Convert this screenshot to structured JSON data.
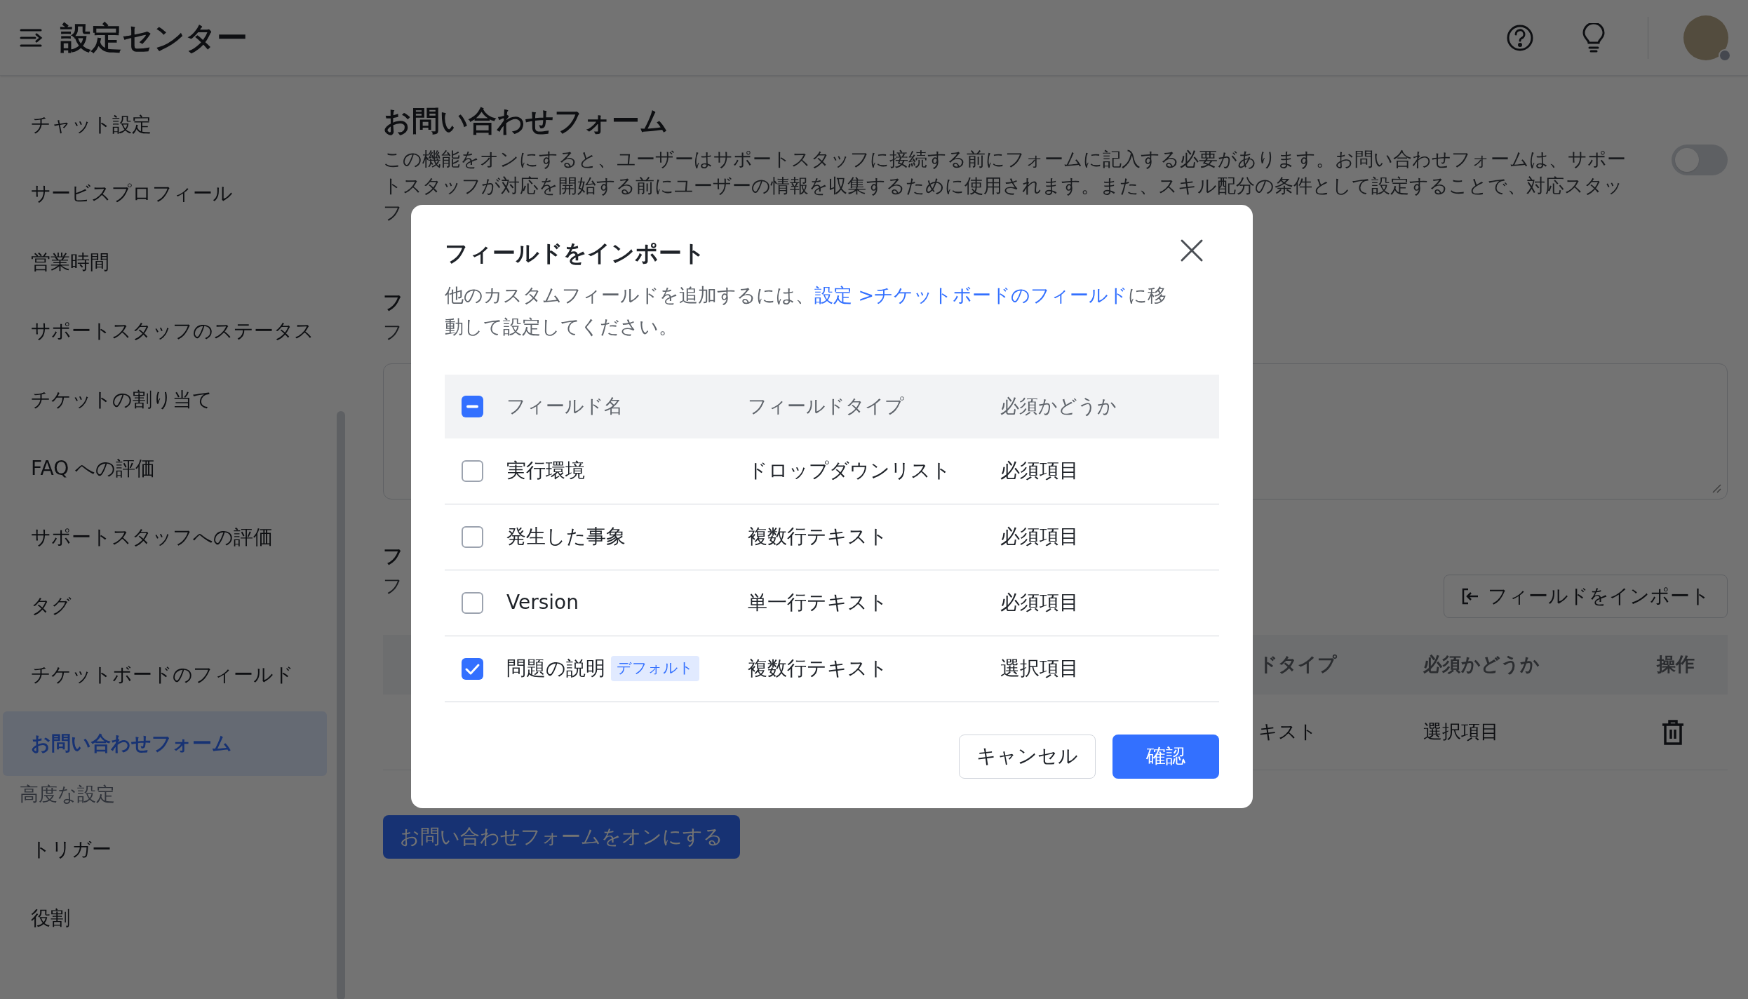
{
  "header": {
    "title": "設定センター"
  },
  "sidebar": {
    "items": [
      {
        "label": "チャット設定",
        "selected": false
      },
      {
        "label": "サービスプロフィール",
        "selected": false
      },
      {
        "label": "営業時間",
        "selected": false
      },
      {
        "label": "サポートスタッフのステータス",
        "selected": false
      },
      {
        "label": "チケットの割り当て",
        "selected": false
      },
      {
        "label": "FAQ への評価",
        "selected": false
      },
      {
        "label": "サポートスタッフへの評価",
        "selected": false
      },
      {
        "label": "タグ",
        "selected": false
      },
      {
        "label": "チケットボードのフィールド",
        "selected": false
      },
      {
        "label": "お問い合わせフォーム",
        "selected": true
      }
    ],
    "section": {
      "label": "高度な設定",
      "items": [
        {
          "label": "トリガー",
          "selected": false
        },
        {
          "label": "役割",
          "selected": false
        }
      ]
    }
  },
  "page": {
    "title": "お問い合わせフォーム",
    "description_lines": [
      "この機能をオンにすると、ユーザーはサポートスタッフに接続する前にフォームに記入する必要があります。お問い合わせフォームは、サポー",
      "トスタッフが対応を開始する前にユーザーの情報を収集するために使用されます。また、スキル配分の条件として設定することで、対応スタッ",
      "フ"
    ],
    "toggle": {
      "on": false
    },
    "section_1": {
      "title": "フ",
      "subtitle": "フ"
    },
    "section_2": {
      "title": "フ",
      "subtitle": "フ"
    },
    "import_button": "フィールドをインポート",
    "table": {
      "columns": [
        "ドタイプ",
        "必須かどうか",
        "操作"
      ],
      "rows": [
        {
          "cells": [
            "キスト",
            "選択項目"
          ]
        }
      ]
    },
    "enable_button": "お問い合わせフォームをオンにする"
  },
  "dialog": {
    "title": "フィールドをインポート",
    "description_before": "他のカスタムフィールドを追加するには、",
    "link": "設定 >チケットボードのフィールド",
    "description_after": "に移動して設定してください。",
    "select_all": {
      "mixed": true
    },
    "columns": [
      "フィールド名",
      "フィールドタイプ",
      "必須かどうか"
    ],
    "rows": [
      {
        "checked": false,
        "name": "実行環境",
        "type": "ドロップダウンリスト",
        "required": "必須項目"
      },
      {
        "checked": false,
        "name": "発生した事象",
        "type": "複数行テキスト",
        "required": "必須項目"
      },
      {
        "checked": false,
        "name": "Version",
        "type": "単一行テキスト",
        "required": "必須項目"
      },
      {
        "checked": true,
        "name": "問題の説明",
        "tag": "デフォルト",
        "type": "複数行テキスト",
        "required": "選択項目"
      }
    ],
    "buttons": {
      "cancel": "キャンセル",
      "confirm": "確認"
    }
  }
}
